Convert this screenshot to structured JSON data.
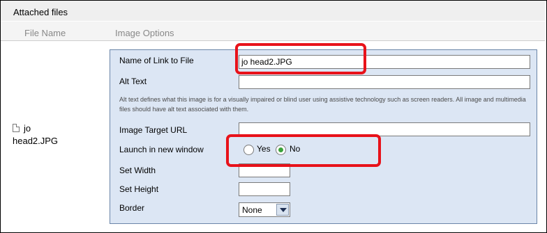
{
  "section": {
    "title": "Attached files"
  },
  "columns": {
    "file_name": "File Name",
    "image_options": "Image Options"
  },
  "file": {
    "name_line1": "jo",
    "name_line2": "head2.JPG",
    "icon": "document-icon"
  },
  "options": {
    "link_name": {
      "label": "Name of Link to File",
      "value": "jo head2.JPG"
    },
    "alt_text": {
      "label": "Alt Text",
      "value": "",
      "help": "Alt text defines what this image is for a visually impaired or blind user using assistive technology such as screen readers. All image and multimedia files should have alt text associated with them."
    },
    "target_url": {
      "label": "Image Target URL",
      "value": ""
    },
    "launch_new_window": {
      "label": "Launch in new window",
      "yes": "Yes",
      "no": "No",
      "selected": "No"
    },
    "width": {
      "label": "Set Width",
      "value": ""
    },
    "height": {
      "label": "Set Height",
      "value": ""
    },
    "border": {
      "label": "Border",
      "selected": "None"
    }
  },
  "colors": {
    "highlight": "#e8121a",
    "panel_bg": "#dce6f4",
    "panel_border": "#6a85a8"
  }
}
